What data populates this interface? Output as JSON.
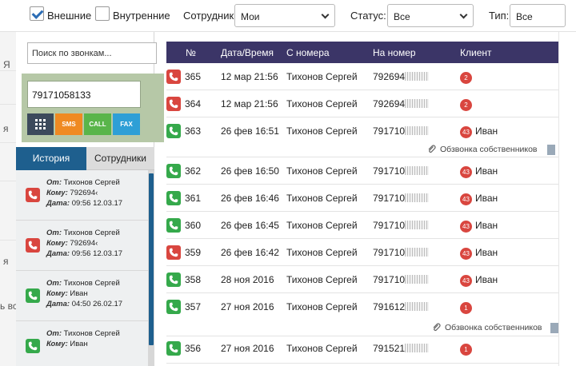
{
  "filters": {
    "external_label": "Внешние",
    "internal_label": "Внутренние",
    "employee_label": "Сотрудник:",
    "employee_value": "Мои",
    "status_label": "Статус:",
    "status_value": "Все",
    "type_label": "Тип:",
    "type_value": "Все"
  },
  "background": {
    "text_a": "Я",
    "text_b": "я",
    "text_c": "я",
    "text_d": "ь вс"
  },
  "softphone": {
    "search_placeholder": "Поиск по звонкам...",
    "number": "79171058133",
    "buttons": {
      "sms": "SMS",
      "call": "CALL",
      "fax": "FAX"
    },
    "colors": {
      "keypad": "#3c4a5c",
      "sms": "#ef8a22",
      "call": "#59b54a",
      "fax": "#2e9fd6",
      "tab_active": "#1e5f8e"
    },
    "tabs": {
      "history": "История",
      "employees": "Сотрудники"
    },
    "history": [
      {
        "status": "missed",
        "from_label": "От:",
        "from": "Тихонов Сергей",
        "to_label": "Кому:",
        "to": "792694‹",
        "date_label": "Дата:",
        "date": "09:56 12.03.17"
      },
      {
        "status": "missed",
        "from_label": "От:",
        "from": "Тихонов Сергей",
        "to_label": "Кому:",
        "to": "792694‹",
        "date_label": "Дата:",
        "date": "09:56 12.03.17"
      },
      {
        "status": "answered",
        "from_label": "От:",
        "from": "Тихонов Сергей",
        "to_label": "Кому:",
        "to": "Иван",
        "date_label": "Дата:",
        "date": "04:50 26.02.17"
      },
      {
        "status": "answered",
        "from_label": "От:",
        "from": "Тихонов Сергей",
        "to_label": "Кому:",
        "to": "Иван",
        "date_label": "",
        "date": ""
      }
    ]
  },
  "table": {
    "headers": {
      "num": "№",
      "datetime": "Дата/Время",
      "from": "С номера",
      "to": "На номер",
      "client": "Клиент"
    },
    "rows": [
      {
        "status": "missed",
        "num": "365",
        "datetime": "12 мар 21:56",
        "from": "Тихонов Сергей",
        "to": "792694",
        "badge": "2",
        "client": ""
      },
      {
        "status": "missed",
        "num": "364",
        "datetime": "12 мар 21:56",
        "from": "Тихонов Сергей",
        "to": "792694",
        "badge": "2",
        "client": ""
      },
      {
        "status": "answered",
        "num": "363",
        "datetime": "26 фев 16:51",
        "from": "Тихонов Сергей",
        "to": "791710",
        "badge": "43",
        "client": "Иван",
        "note": "Обзвонка собственников"
      },
      {
        "status": "answered",
        "num": "362",
        "datetime": "26 фев 16:50",
        "from": "Тихонов Сергей",
        "to": "791710",
        "badge": "43",
        "client": "Иван"
      },
      {
        "status": "answered",
        "num": "361",
        "datetime": "26 фев 16:46",
        "from": "Тихонов Сергей",
        "to": "791710",
        "badge": "43",
        "client": "Иван"
      },
      {
        "status": "answered",
        "num": "360",
        "datetime": "26 фев 16:45",
        "from": "Тихонов Сергей",
        "to": "791710",
        "badge": "43",
        "client": "Иван"
      },
      {
        "status": "missed",
        "num": "359",
        "datetime": "26 фев 16:42",
        "from": "Тихонов Сергей",
        "to": "791710",
        "badge": "43",
        "client": "Иван"
      },
      {
        "status": "answered",
        "num": "358",
        "datetime": "28 ноя 2016",
        "from": "Тихонов Сергей",
        "to": "791710",
        "badge": "43",
        "client": "Иван"
      },
      {
        "status": "answered",
        "num": "357",
        "datetime": "27 ноя 2016",
        "from": "Тихонов Сергей",
        "to": "791612",
        "badge": "1",
        "client": "",
        "note": "Обзвонка собственников"
      },
      {
        "status": "answered",
        "num": "356",
        "datetime": "27 ноя 2016",
        "from": "Тихонов Сергей",
        "to": "791521",
        "badge": "1",
        "client": ""
      }
    ]
  },
  "colors": {
    "missed": "#d9463f",
    "answered": "#35a94b",
    "header": "#3b3567",
    "badge": "#d9463f"
  }
}
